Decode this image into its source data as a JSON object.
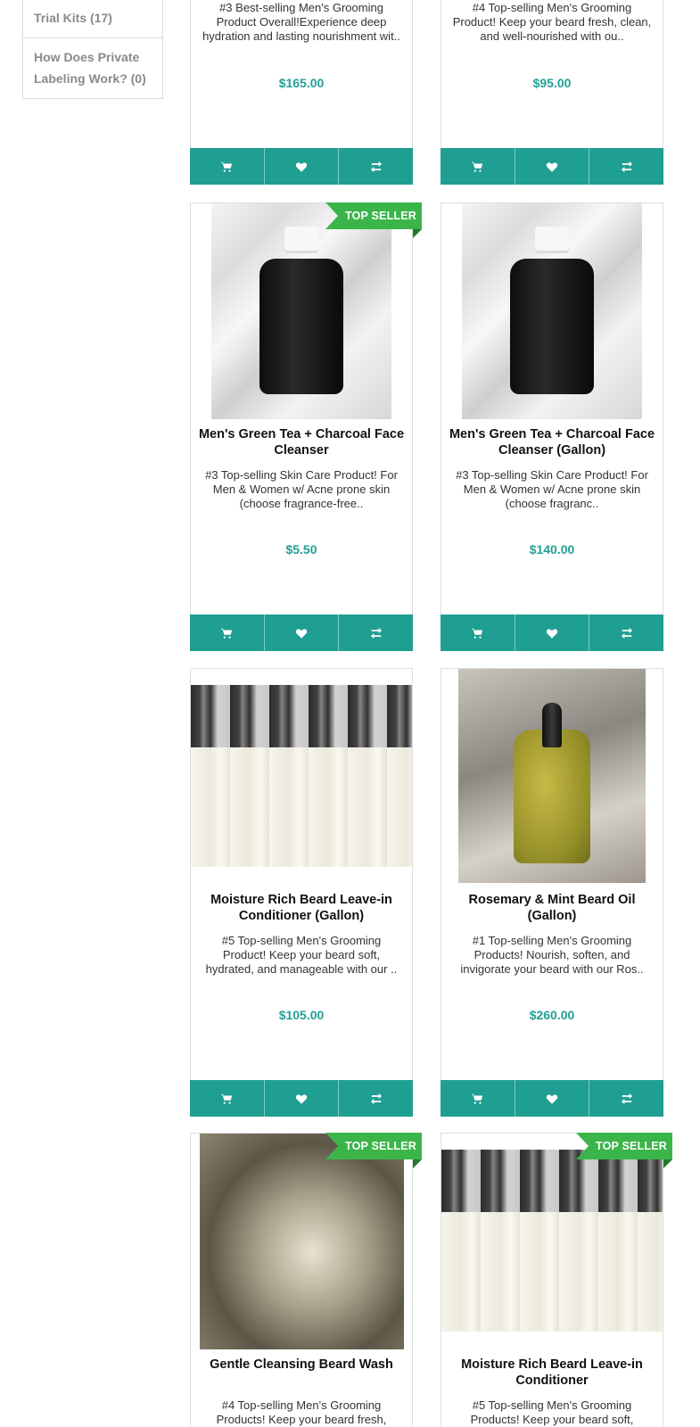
{
  "sidebar": {
    "items": [
      {
        "label": "Trial Kits (17)"
      },
      {
        "label": "How Does Private Labeling Work? (0)"
      }
    ]
  },
  "products": [
    {
      "name": "",
      "description": "#3 Best-selling Men's Grooming Product Overall!Experience deep hydration and lasting nourishment wit..",
      "price": "$165.00",
      "badge": ""
    },
    {
      "name": "",
      "description": "#4 Top-selling Men's Grooming Product! Keep your beard fresh, clean, and well-nourished with ou..",
      "price": "$95.00",
      "badge": ""
    },
    {
      "name": "Men's Green Tea + Charcoal Face Cleanser",
      "description": "#3 Top-selling Skin Care Product! For Men & Women w/ Acne prone skin (choose fragrance-free..",
      "price": "$5.50",
      "badge": "TOP SELLER"
    },
    {
      "name": "Men's Green Tea + Charcoal Face Cleanser (Gallon)",
      "description": "#3 Top-selling Skin Care Product!  For Men & Women w/ Acne prone skin (choose fragranc..",
      "price": "$140.00",
      "badge": ""
    },
    {
      "name": "Moisture Rich Beard Leave-in Conditioner (Gallon)",
      "description": "#5 Top-selling Men's Grooming Product! Keep your beard soft, hydrated, and manageable with our ..",
      "price": "$105.00",
      "badge": ""
    },
    {
      "name": "Rosemary & Mint Beard Oil (Gallon)",
      "description": "#1 Top-selling Men's Grooming Products! Nourish, soften, and invigorate your beard with our Ros..",
      "price": "$260.00",
      "badge": ""
    },
    {
      "name": "Gentle Cleansing Beard Wash",
      "description": "#4 Top-selling Men's Grooming Products! Keep your beard fresh,",
      "price": "",
      "badge": "TOP SELLER"
    },
    {
      "name": "Moisture Rich Beard Leave-in Conditioner",
      "description": "#5 Top-selling Men's Grooming Products! Keep your beard soft,",
      "price": "",
      "badge": "TOP SELLER"
    }
  ],
  "icons": {
    "cart": "cart-icon",
    "wishlist": "heart-icon",
    "compare": "compare-arrows-icon"
  },
  "colors": {
    "accent": "#1f9e92",
    "price": "#229e96",
    "badge": "#3bb54a"
  }
}
